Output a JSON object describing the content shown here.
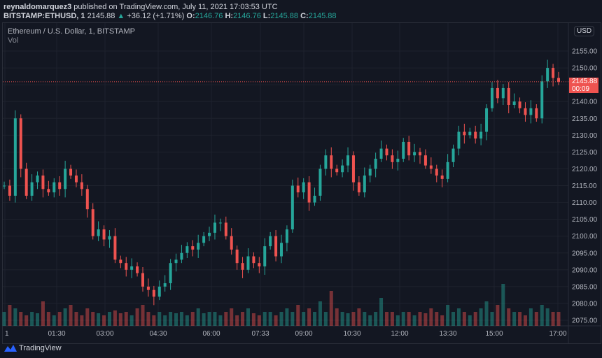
{
  "header": {
    "author": "reynaldomarquez3",
    "published": "published on TradingView.com, July 11, 2021 17:03:53 UTC",
    "symbol": "BITSTAMP:ETHUSD, 1",
    "last": "2145.88",
    "arrow": "▲",
    "change": "+36.12 (+1.71%)",
    "o_label": "O:",
    "o": "2146.76",
    "h_label": "H:",
    "h": "2146.76",
    "l_label": "L:",
    "l": "2145.88",
    "c_label": "C:",
    "c": "2145.88"
  },
  "legend": {
    "title": "Ethereum / U.S. Dollar, 1, BITSTAMP",
    "vol": "Vol"
  },
  "currency": "USD",
  "price_tag": {
    "price": "2145.88",
    "countdown": "00:09"
  },
  "branding": "TradingView",
  "colors": {
    "up": "#26a69a",
    "down": "#ef5350",
    "bg": "#131722",
    "grid": "#1e222d"
  },
  "chart_data": {
    "type": "candlestick",
    "title": "Ethereum / U.S. Dollar, 1, BITSTAMP",
    "ylim": [
      2073,
      2157
    ],
    "yticks": [
      "2155.00",
      "2150.00",
      "2145.00",
      "2140.00",
      "2135.00",
      "2130.00",
      "2125.00",
      "2120.00",
      "2115.00",
      "2110.00",
      "2105.00",
      "2100.00",
      "2095.00",
      "2090.00",
      "2085.00",
      "2080.00",
      "2075.00"
    ],
    "xticks": [
      "1",
      "01:30",
      "03:00",
      "04:30",
      "06:00",
      "07:33",
      "09:00",
      "10:30",
      "12:00",
      "13:30",
      "15:00",
      "17:00"
    ],
    "last_price": 2145.88,
    "closes": [
      2115,
      2112,
      2135,
      2120,
      2112,
      2116,
      2118,
      2114,
      2113,
      2116,
      2114,
      2120,
      2118,
      2116,
      2114,
      2108,
      2100,
      2102,
      2099,
      2100,
      2093,
      2092,
      2090,
      2091,
      2089,
      2085,
      2084,
      2082,
      2085,
      2086,
      2092,
      2093,
      2095,
      2097,
      2096,
      2098,
      2100,
      2101,
      2104,
      2104,
      2100,
      2096,
      2092,
      2090,
      2094,
      2092,
      2091,
      2097,
      2100,
      2094,
      2098,
      2102,
      2115,
      2113,
      2116,
      2110,
      2112,
      2120,
      2124,
      2120,
      2119,
      2121,
      2124,
      2116,
      2113,
      2118,
      2120,
      2123,
      2126,
      2124,
      2122,
      2123,
      2128,
      2124,
      2125,
      2124,
      2121,
      2120,
      2118,
      2117,
      2122,
      2126,
      2131,
      2130,
      2131,
      2129,
      2131,
      2138,
      2144,
      2141,
      2144,
      2139,
      2140,
      2138,
      2136,
      2138,
      2135,
      2146,
      2150,
      2147,
      2145.88
    ],
    "volumes": [
      0.2,
      0.3,
      0.25,
      0.2,
      0.15,
      0.2,
      0.18,
      0.35,
      0.2,
      0.15,
      0.2,
      0.25,
      0.3,
      0.2,
      0.15,
      0.25,
      0.2,
      0.18,
      0.15,
      0.2,
      0.22,
      0.18,
      0.2,
      0.15,
      0.25,
      0.3,
      0.2,
      0.15,
      0.2,
      0.15,
      0.2,
      0.18,
      0.2,
      0.15,
      0.2,
      0.25,
      0.18,
      0.2,
      0.2,
      0.15,
      0.2,
      0.25,
      0.15,
      0.2,
      0.25,
      0.18,
      0.15,
      0.2,
      0.2,
      0.15,
      0.2,
      0.25,
      0.2,
      0.3,
      0.2,
      0.25,
      0.2,
      0.35,
      0.2,
      0.5,
      0.25,
      0.2,
      0.18,
      0.2,
      0.25,
      0.2,
      0.15,
      0.2,
      0.4,
      0.2,
      0.2,
      0.15,
      0.2,
      0.2,
      0.15,
      0.2,
      0.18,
      0.25,
      0.2,
      0.15,
      0.3,
      0.2,
      0.25,
      0.2,
      0.15,
      0.2,
      0.25,
      0.35,
      0.2,
      0.3,
      0.6,
      0.25,
      0.2,
      0.2,
      0.15,
      0.25,
      0.2,
      0.3,
      0.25,
      0.2,
      0.2
    ]
  }
}
